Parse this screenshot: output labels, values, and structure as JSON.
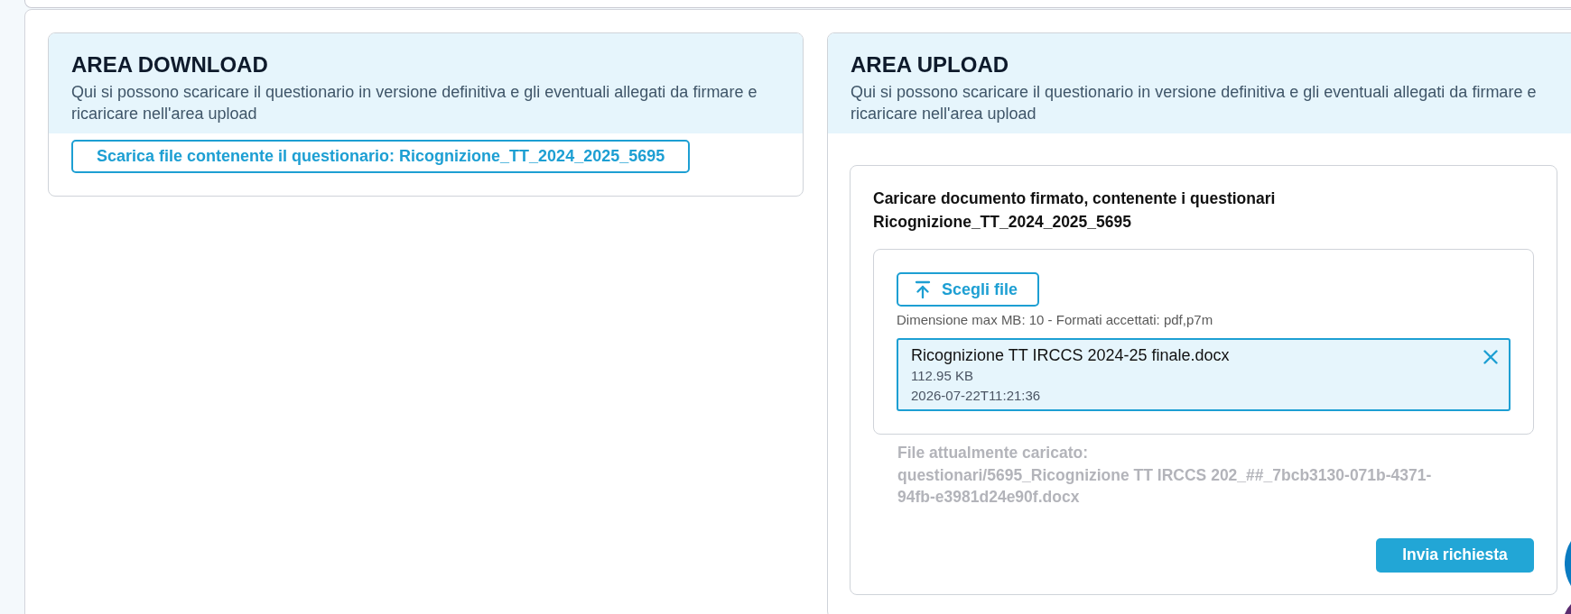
{
  "download_area": {
    "title": "AREA DOWNLOAD",
    "description": "Qui si possono scaricare il questionario in versione definitiva e gli eventuali allegati da firmare e ricaricare nell'area upload",
    "download_button": "Scarica file contenente il questionario: Ricognizione_TT_2024_2025_5695"
  },
  "upload_area": {
    "title": "AREA UPLOAD",
    "description": "Qui si possono scaricare il questionario in versione definitiva e gli eventuali allegati da firmare e ricaricare nell'area upload",
    "form": {
      "instructions": [
        "Caricare documento firmato, contenente i questionari",
        "Ricognizione_TT_2024_2025_5695"
      ],
      "choose_button": "Scegli file",
      "hint": "Dimensione max MB: 10 - Formati accettati: pdf,p7m",
      "selected_files": [
        {
          "name": "Ricognizione TT IRCCS 2024-25 finale.docx",
          "size": "112.95 KB",
          "date": "2026-07-22T11:21:36"
        }
      ],
      "current_file_label": "File attualmente caricato:",
      "current_file_path": "questionari/5695_Ricognizione TT IRCCS 202_##_7bcb3130-071b-4371-94fb-e3981d24e90f.docx",
      "submit_button": "Invia richiesta"
    }
  }
}
